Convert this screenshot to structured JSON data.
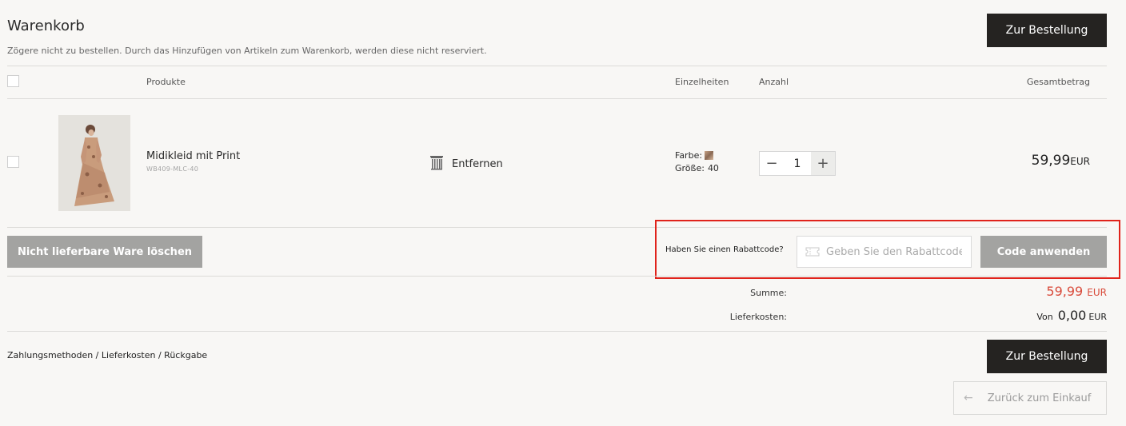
{
  "header": {
    "title": "Warenkorb",
    "subtitle": "Zögere nicht zu bestellen. Durch das Hinzufügen von Artikeln zum Warenkorb, werden diese nicht reserviert.",
    "order_button": "Zur Bestellung"
  },
  "table": {
    "columns": {
      "products": "Produkte",
      "details": "Einzelheiten",
      "quantity": "Anzahl",
      "total": "Gesamtbetrag"
    }
  },
  "item": {
    "name": "Midikleid mit Print",
    "sku": "WB409-MLC-40",
    "remove_label": "Entfernen",
    "color_label": "Farbe:",
    "size_label": "Größe:",
    "size_value": "40",
    "quantity": "1",
    "price": "59,99",
    "currency": "EUR"
  },
  "actions": {
    "delete_unavailable": "Nicht lieferbare Ware löschen"
  },
  "discount": {
    "question": "Haben Sie einen Rabattcode?",
    "placeholder": "Geben Sie den Rabattcode ein",
    "apply_button": "Code anwenden"
  },
  "summary": {
    "sum_label": "Summe:",
    "sum_value": "59,99",
    "sum_currency": "EUR",
    "shipping_label": "Lieferkosten:",
    "shipping_prefix": "Von",
    "shipping_value": "0,00",
    "shipping_currency": "EUR"
  },
  "footer": {
    "links": "Zahlungsmethoden / Lieferkosten / Rückgabe",
    "order_button": "Zur Bestellung",
    "back_button": "Zurück zum Einkauf",
    "back_arrow": "←"
  },
  "colors": {
    "dark_button": "#252321",
    "grey_button": "#a3a3a1",
    "price_red": "#d94b3b",
    "highlight_red": "#e0231b"
  }
}
